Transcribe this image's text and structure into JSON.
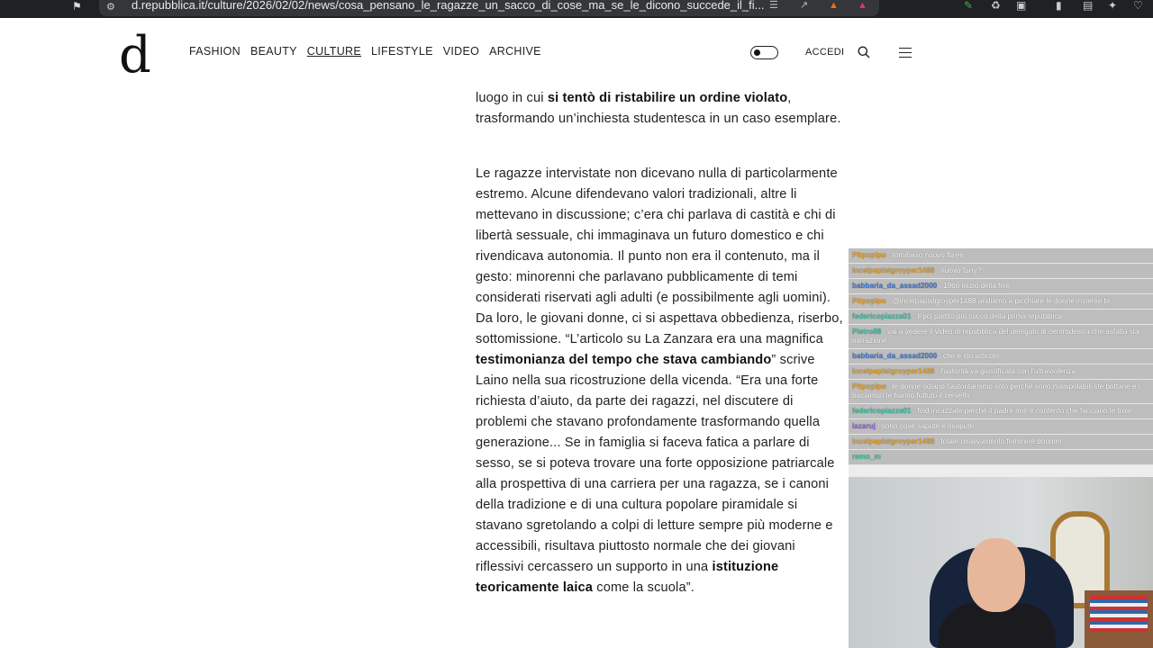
{
  "browser": {
    "url": "d.repubblica.it/culture/2026/02/02/news/cosa_pensano_le_ragazze_un_sacco_di_cose_ma_se_le_dicono_succede_il_fi..."
  },
  "site": {
    "logo": "d",
    "nav": [
      "FASHION",
      "BEAUTY",
      "CULTURE",
      "LIFESTYLE",
      "VIDEO",
      "ARCHIVE"
    ],
    "active_nav": "CULTURE",
    "login_label": "ACCEDI"
  },
  "article": {
    "p0_lead": "luogo in cui ",
    "p0_bold": "si tentò di ristabilire un ordine violato",
    "p0_rest": ", trasformando un’inchiesta studentesca in un caso esemplare.",
    "p1_a": "Le ragazze intervistate non dicevano nulla di particolarmente estremo. Alcune difendevano valori tradizionali, altre li mettevano in discussione; c’era chi parlava di castità e chi di libertà sessuale, chi immaginava un futuro domestico e chi rivendicava autonomia. Il punto non era il contenuto, ma il gesto: minorenni che parlavano pubblicamente di temi considerati riservati agli adulti (e possibilmente agli uomini). Da loro, le giovani donne, ci si aspettava obbedienza, riserbo, sottomissione. “L’articolo su La Zanzara era una magnifica ",
    "p1_b1": "testimonianza del tempo che stava cambiando",
    "p1_c": "” scrive Laino nella sua ricostruzione della vicenda. “Era una forte richiesta d’aiuto, da parte dei ragazzi, nel discutere di problemi che stavano profondamente trasformando quella generazione... Se in famiglia si faceva fatica a parlare di sesso, se si poteva trovare una forte opposizione patriarcale alla prospettiva di una carriera per una ragazza, se i canoni della tradizione e di una cultura popolare piramidale si stavano sgretolando a colpi di letture sempre più moderne e accessibili, risultava piuttosto normale che dei giovani riflessivi cercassero un supporto in una ",
    "p1_b2": "istituzione teoricamente laica",
    "p1_d": " come la scuola”."
  },
  "chat": {
    "messages": [
      {
        "user": "Pitpopipo",
        "color": "#e0a030",
        "text": " : tommaso nuovo furerr"
      },
      {
        "user": "incelpapistgroyper1488",
        "color": "#e0a030",
        "text": " : nuovo furry?"
      },
      {
        "user": "babbaria_da_assad2000",
        "color": "#3c7bd8",
        "text": " : 1966 inizio della fine"
      },
      {
        "user": "Pitpopipo",
        "color": "#e0a030",
        "text": " : @incelpapistgroyper1488 andiamo a picchiare le donne insieme br"
      },
      {
        "user": "federicopiazza01",
        "color": "#39c2a0",
        "text": " : il pci partito più cucco della prima repubblica"
      },
      {
        "user": "Pietro88",
        "color": "#39c2a0",
        "text": " : vai a vedere il video di repubblica del delegato di centrodestra che asfalta sta narrazione"
      },
      {
        "user": "babbaria_da_assad2000",
        "color": "#3c7bd8",
        "text": " : che e sto articolo"
      },
      {
        "user": "incelpapistgroyper1488",
        "color": "#e0a030",
        "text": " : l'autorità va giustificata con l'ultraviolenza"
      },
      {
        "user": "Pitpopipo",
        "color": "#e0a030",
        "text": " : le donne odiano l'autoritarismo solo perché sono manipolabili ste bottane e i baciamuri le hanno fottuto il cervello"
      },
      {
        "user": "federicopiazza01",
        "color": "#39c2a0",
        "text": " : foid incazzate perché il padre non è contento che facciano le troie"
      },
      {
        "user": "lazaruj",
        "color": "#9b5de5",
        "text": " : sono cose sapute e risapute"
      },
      {
        "user": "incelpapistgroyper1488",
        "color": "#e0a030",
        "text": " : totale unalivamento femmine boomer"
      },
      {
        "user": "remo_m",
        "color": "#39c2a0",
        "text": " : "
      }
    ]
  }
}
